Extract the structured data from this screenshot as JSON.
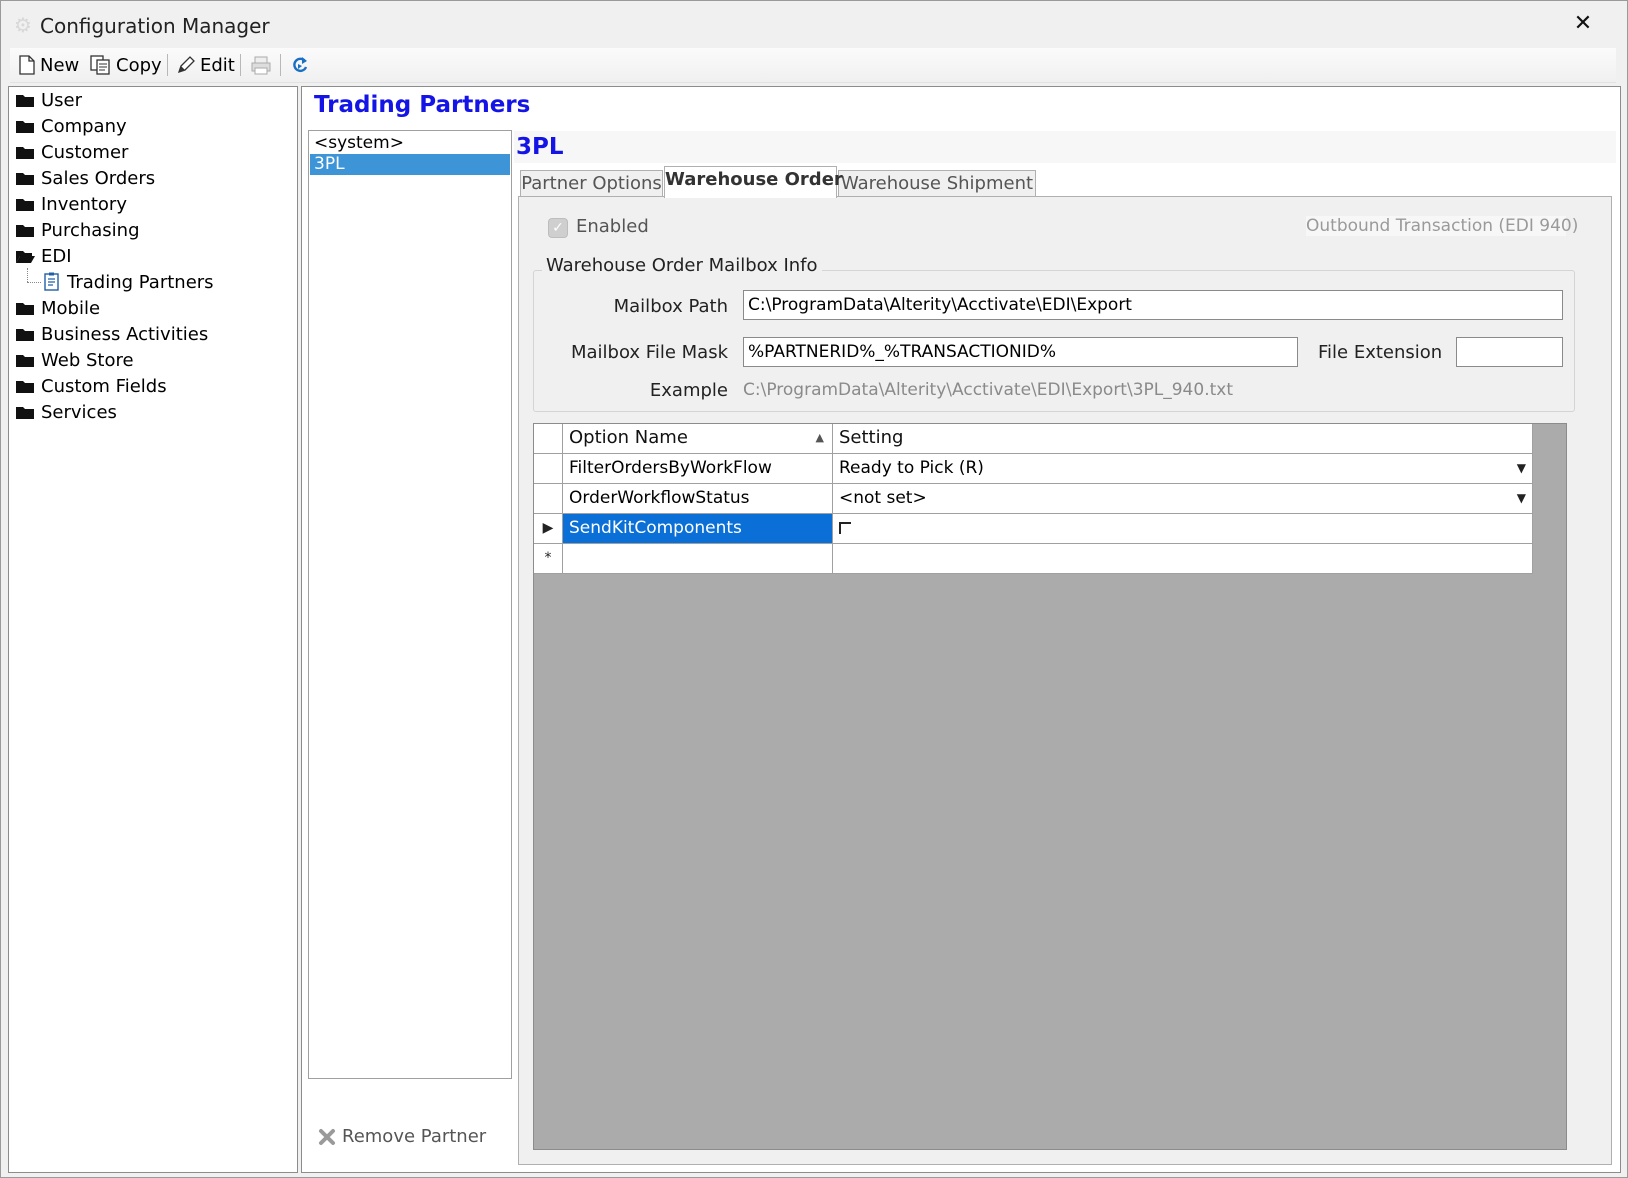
{
  "window": {
    "title": "Configuration Manager",
    "close_glyph": "✕"
  },
  "toolbar": {
    "new_label": "New",
    "copy_label": "Copy",
    "edit_label": "Edit"
  },
  "tree": {
    "items": [
      {
        "label": "User",
        "icon": "folder-icon"
      },
      {
        "label": "Company",
        "icon": "folder-icon"
      },
      {
        "label": "Customer",
        "icon": "folder-icon"
      },
      {
        "label": "Sales Orders",
        "icon": "folder-icon"
      },
      {
        "label": "Inventory",
        "icon": "folder-icon"
      },
      {
        "label": "Purchasing",
        "icon": "folder-icon"
      },
      {
        "label": "EDI",
        "icon": "folder-open-icon"
      },
      {
        "label": "Trading Partners",
        "icon": "document-icon"
      },
      {
        "label": "Mobile",
        "icon": "folder-icon"
      },
      {
        "label": "Business Activities",
        "icon": "folder-icon"
      },
      {
        "label": "Web Store",
        "icon": "folder-icon"
      },
      {
        "label": "Custom Fields",
        "icon": "folder-icon"
      },
      {
        "label": "Services",
        "icon": "folder-icon"
      }
    ]
  },
  "main": {
    "section_title": "Trading Partners",
    "partners": [
      "<system>",
      "3PL"
    ],
    "selected_partner": "3PL",
    "remove_partner_label": "Remove Partner",
    "partner_name": "3PL",
    "tabs": [
      {
        "label": "Partner Options"
      },
      {
        "label": "Warehouse Order"
      },
      {
        "label": "Warehouse Shipment"
      }
    ],
    "enabled_label": "Enabled",
    "outbound_label": "Outbound Transaction (EDI 940)",
    "mailbox": {
      "legend": "Warehouse Order Mailbox Info",
      "path_label": "Mailbox Path",
      "path_value": "C:\\ProgramData\\Alterity\\Acctivate\\EDI\\Export",
      "mask_label": "Mailbox File Mask",
      "mask_value": "%PARTNERID%_%TRANSACTIONID%",
      "ext_label": "File Extension",
      "ext_value": "",
      "example_label": "Example",
      "example_value": "C:\\ProgramData\\Alterity\\Acctivate\\EDI\\Export\\3PL_940.txt"
    },
    "grid": {
      "col_option": "Option Name",
      "col_setting": "Setting",
      "rows": [
        {
          "option": "FilterOrdersByWorkFlow",
          "setting": "Ready to Pick (R)"
        },
        {
          "option": "OrderWorkflowStatus",
          "setting": "<not set>"
        },
        {
          "option": "SendKitComponents",
          "setting": ""
        }
      ],
      "current_row_glyph": "▶",
      "new_row_glyph": "*"
    }
  },
  "colors": {
    "accent_title": "#1414e6",
    "selection": "#0a6fd6",
    "list_selection": "#3d95d8"
  }
}
